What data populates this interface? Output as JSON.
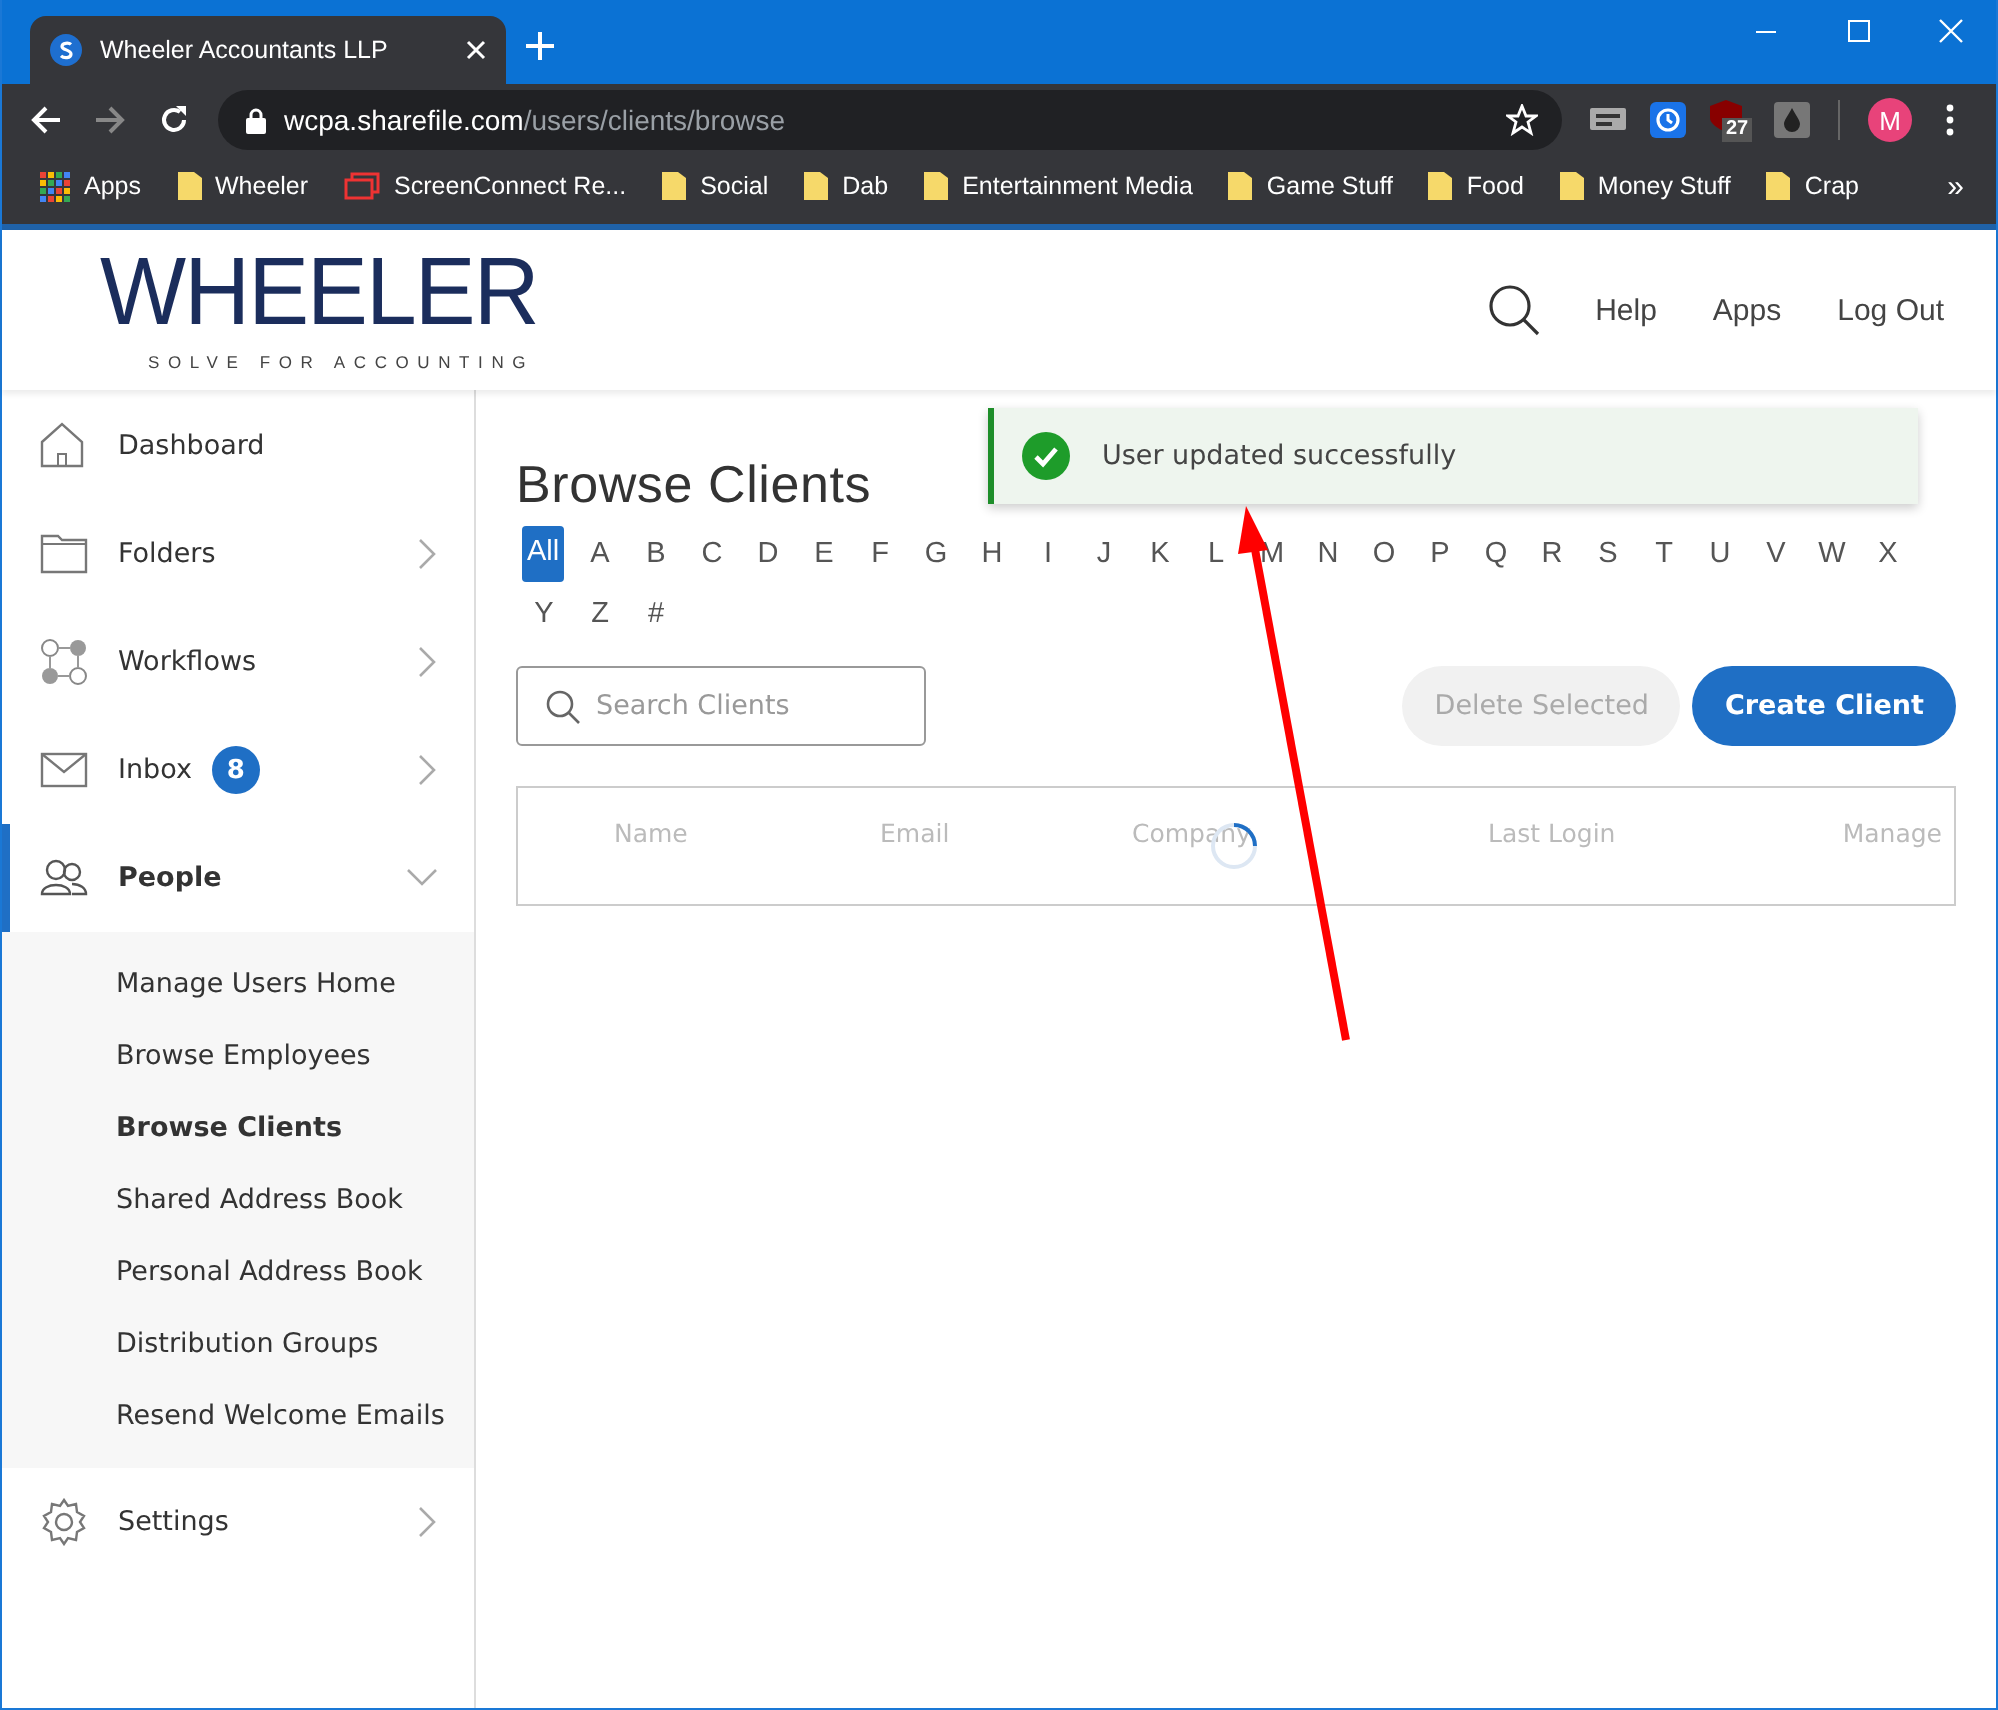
{
  "browser": {
    "tab": {
      "title": "Wheeler Accountants LLP"
    },
    "url": {
      "host": "wcpa.sharefile.com",
      "path": "/users/clients/browse"
    },
    "extension_badge": "27",
    "profile_initial": "M",
    "bookmarks": [
      {
        "label": "Apps",
        "kind": "apps"
      },
      {
        "label": "Wheeler",
        "kind": "folder"
      },
      {
        "label": "ScreenConnect Re...",
        "kind": "page"
      },
      {
        "label": "Social",
        "kind": "folder"
      },
      {
        "label": "Dab",
        "kind": "folder"
      },
      {
        "label": "Entertainment Media",
        "kind": "folder"
      },
      {
        "label": "Game Stuff",
        "kind": "folder"
      },
      {
        "label": "Food",
        "kind": "folder"
      },
      {
        "label": "Money Stuff",
        "kind": "folder"
      },
      {
        "label": "Crap",
        "kind": "folder"
      }
    ],
    "bookmarks_overflow": "»"
  },
  "header": {
    "logo": {
      "wordmark": "WHEELER",
      "tagline": "SOLVE FOR ACCOUNTING"
    },
    "nav": [
      "Help",
      "Apps",
      "Log Out"
    ]
  },
  "sidebar": {
    "items": [
      {
        "label": "Dashboard",
        "kind": "link",
        "selected": false
      },
      {
        "label": "Folders",
        "kind": "group",
        "expanded": false,
        "selected": false
      },
      {
        "label": "Workflows",
        "kind": "group",
        "expanded": false,
        "selected": false
      },
      {
        "label": "Inbox",
        "kind": "group",
        "badge": "8",
        "expanded": false,
        "selected": false
      },
      {
        "label": "People",
        "kind": "group",
        "expanded": true,
        "selected": true,
        "children": [
          {
            "label": "Manage Users Home",
            "selected": false
          },
          {
            "label": "Browse Employees",
            "selected": false
          },
          {
            "label": "Browse Clients",
            "selected": true
          },
          {
            "label": "Shared Address Book",
            "selected": false
          },
          {
            "label": "Personal Address Book",
            "selected": false
          },
          {
            "label": "Distribution Groups",
            "selected": false
          },
          {
            "label": "Resend Welcome Emails",
            "selected": false
          }
        ]
      },
      {
        "label": "Settings",
        "kind": "group",
        "expanded": false,
        "selected": false
      }
    ]
  },
  "main": {
    "title": "Browse Clients",
    "letters": [
      {
        "label": "All",
        "selected": true
      },
      {
        "label": "A",
        "selected": false
      },
      {
        "label": "B",
        "selected": false
      },
      {
        "label": "C",
        "selected": false
      },
      {
        "label": "D",
        "selected": false
      },
      {
        "label": "E",
        "selected": false
      },
      {
        "label": "F",
        "selected": false
      },
      {
        "label": "G",
        "selected": false
      },
      {
        "label": "H",
        "selected": false
      },
      {
        "label": "I",
        "selected": false
      },
      {
        "label": "J",
        "selected": false
      },
      {
        "label": "K",
        "selected": false
      },
      {
        "label": "L",
        "selected": false
      },
      {
        "label": "M",
        "selected": false
      },
      {
        "label": "N",
        "selected": false
      },
      {
        "label": "O",
        "selected": false
      },
      {
        "label": "P",
        "selected": false
      },
      {
        "label": "Q",
        "selected": false
      },
      {
        "label": "R",
        "selected": false
      },
      {
        "label": "S",
        "selected": false
      },
      {
        "label": "T",
        "selected": false
      },
      {
        "label": "U",
        "selected": false
      },
      {
        "label": "V",
        "selected": false
      },
      {
        "label": "W",
        "selected": false
      },
      {
        "label": "X",
        "selected": false
      },
      {
        "label": "Y",
        "selected": false
      },
      {
        "label": "Z",
        "selected": false
      },
      {
        "label": "#",
        "selected": false
      }
    ],
    "search": {
      "placeholder": "Search Clients"
    },
    "buttons": [
      {
        "label": "Delete Selected",
        "disabled": true
      },
      {
        "label": "Create Client",
        "disabled": false
      }
    ],
    "table": {
      "columns": [
        "Name",
        "Email",
        "Company",
        "Last Login",
        "Manage"
      ],
      "loading": true
    }
  },
  "toast": {
    "kind": "success",
    "message": "User updated successfully"
  }
}
